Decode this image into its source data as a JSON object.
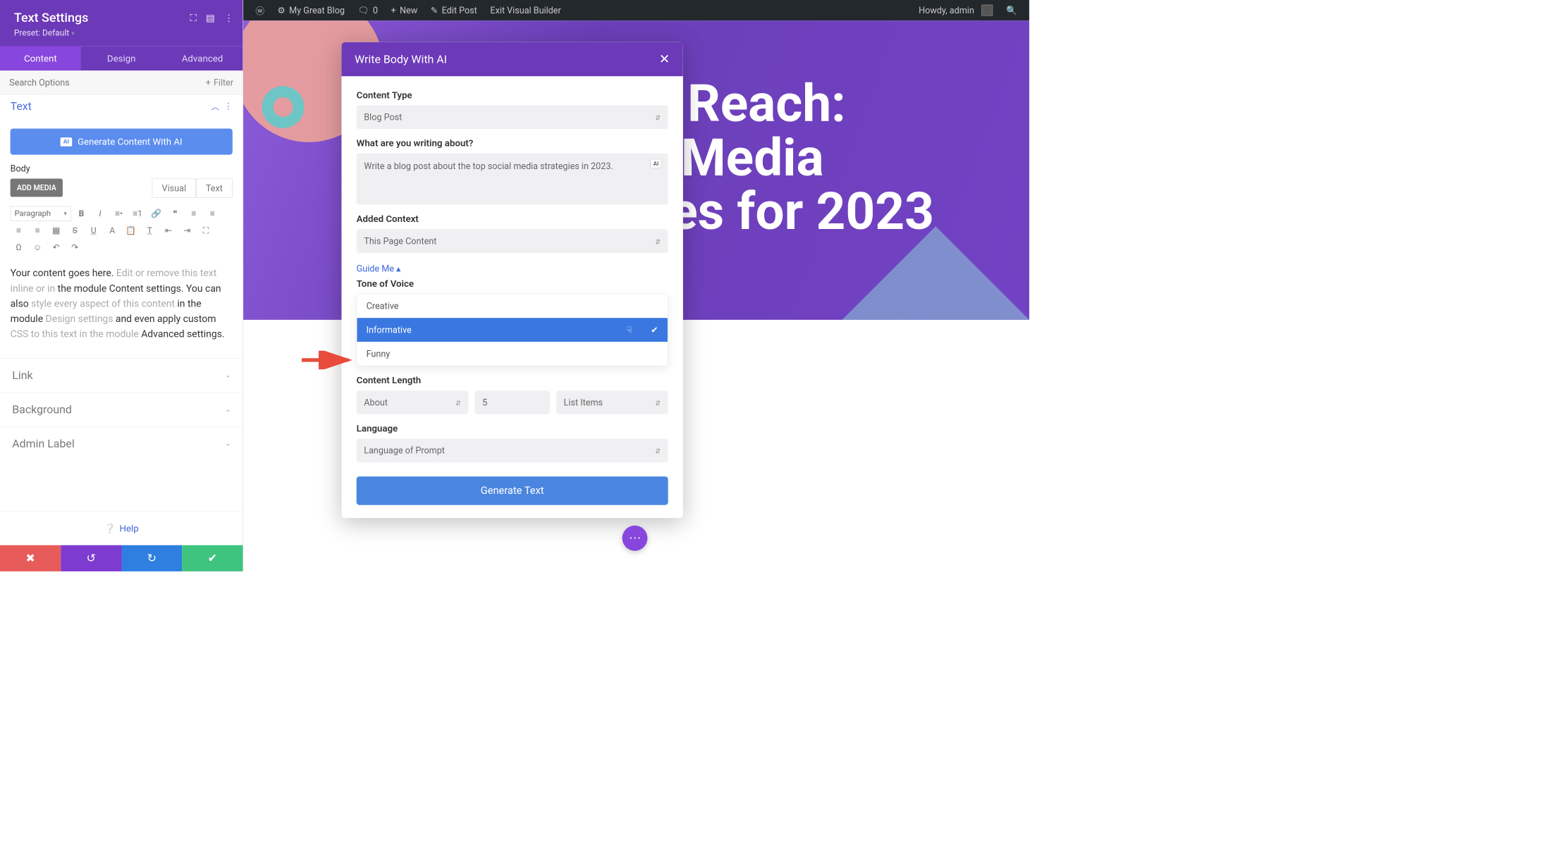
{
  "wpBar": {
    "siteName": "My Great Blog",
    "comments": "0",
    "new": "New",
    "editPost": "Edit Post",
    "exitVB": "Exit Visual Builder",
    "howdy": "Howdy, admin"
  },
  "hero": {
    "title": "ur Reach:\nal Media\ngies for 2023"
  },
  "sidebar": {
    "title": "Text Settings",
    "preset": "Preset: Default",
    "tabs": {
      "content": "Content",
      "design": "Design",
      "advanced": "Advanced"
    },
    "searchPlaceholder": "Search Options",
    "filter": "Filter",
    "section": "Text",
    "generateBtn": "Generate Content With AI",
    "bodyLabel": "Body",
    "addMedia": "ADD MEDIA",
    "edTabs": {
      "visual": "Visual",
      "text": "Text"
    },
    "formatSel": "Paragraph",
    "editorContent": {
      "lead": "Your content goes here. ",
      "muted1": "Edit or remove this text inline or in ",
      "txt2": "the module Content settings. You can also ",
      "muted2": "style every aspect of this content ",
      "txt3": "in the module ",
      "muted3": "Design settings ",
      "txt4": "and even apply custom ",
      "muted4": "CSS to this text in the module ",
      "txt5": "Advanced settings."
    },
    "acc": {
      "link": "Link",
      "background": "Background",
      "adminLabel": "Admin Label"
    },
    "help": "Help"
  },
  "modal": {
    "title": "Write Body With AI",
    "contentTypeLabel": "Content Type",
    "contentType": "Blog Post",
    "aboutLabel": "What are you writing about?",
    "aboutValue": "Write a blog post about the top social media strategies in 2023.",
    "contextLabel": "Added Context",
    "contextValue": "This Page Content",
    "guide": "Guide Me",
    "toneLabel": "Tone of Voice",
    "toneOptions": {
      "creative": "Creative",
      "informative": "Informative",
      "funny": "Funny"
    },
    "lenLabel": "Content Length",
    "lenAbout": "About",
    "lenCount": "5",
    "lenUnit": "List Items",
    "langLabel": "Language",
    "langValue": "Language of Prompt",
    "generate": "Generate Text"
  }
}
